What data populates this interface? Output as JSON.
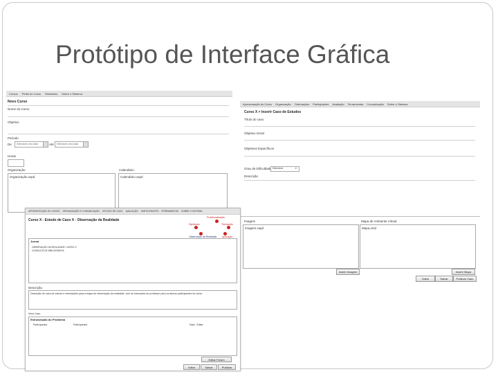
{
  "slide": {
    "title": "Protótipo de Interface Gráfica"
  },
  "shot1": {
    "menu": [
      "Cursos",
      "Perfis do Curso",
      "Relatórios",
      "Sobre o Sistema"
    ],
    "heading": "Novo Curso",
    "fields": {
      "name_label": "Nome do Curso",
      "objectives_label": "Objetivo",
      "period_label": "Período",
      "from_label": "De",
      "from_placeholder": "Selecione uma data",
      "to_label": "Até",
      "to_placeholder": "Selecione uma data",
      "hours_label": "Horas",
      "org_label": "Organização",
      "org_value": "Organização.xspd",
      "calendar_label": "Calendário",
      "calendar_value": "Calendário.xspd"
    }
  },
  "shot2": {
    "menu": [
      "Apresentação do Curso",
      "Organização",
      "Orientações",
      "Participantes",
      "Avaliação",
      "Ferramentas",
      "Comunicação",
      "Sobre o Sistema"
    ],
    "heading": "Curso X > Inserir Caso de Estudos",
    "fields": {
      "name_label": "Título do caso",
      "general_label": "Objetivo Geral",
      "specific_label": "Objetivos Específicos",
      "difficulty_label": "Grau de Dificuldade",
      "difficulty_value": "Selecione",
      "description_label": "Descrição",
      "image_label": "Imagem",
      "image_value": "Imagem.xspd",
      "map_label": "Mapa de Ambiente Virtual",
      "map_value": "Mapa.xmd"
    },
    "buttons": {
      "insert_image": "Inserir Imagem",
      "insert_map": "Inserir Mapa",
      "back": "Voltar",
      "save": "Salvar",
      "publish": "Publicar Caso"
    }
  },
  "shot3": {
    "menu": [
      "APRESENTAÇÃO DO CURSO",
      "ORGANIZAÇÃO E COMUNICAÇÃO",
      "ESTUDO DE CASO",
      "AVALIAÇÃO",
      "PARTICIPANTES",
      "FERRAMENTAS",
      "SOBRE O SISTEMA"
    ],
    "heading": "Curso X - Estudo de Caso X - Observação da Realidade",
    "stages": [
      "Problematização",
      "Hipóteses",
      "Teorização",
      "Observação da Realidade",
      "Aplicação"
    ],
    "journal_label": "Jornal",
    "journal_lines": [
      "OBSERVAÇÃO DA REALIDADE: CURSO X",
      "CONSULTA DE BIBLIOGRAFIA"
    ],
    "description_label": "Descrição",
    "description_text": "Descrição do caso de estudo e orientações para a etapa de observação da realidade, com as instruções do professor para os alunos participantes do curso.",
    "new_item_label": "Novo Caso",
    "table_title": "Estruturação do Problema",
    "table_headers": [
      "Participantes",
      "Participantes",
      "Data - Editar"
    ],
    "buttons": {
      "edit_forum": "Editar Fórum",
      "back": "Voltar",
      "save": "Salvar",
      "publish": "Publicar"
    }
  },
  "colors": {
    "menubar": "#e4e4e4",
    "title": "#555555",
    "stage_red": "#cc2222"
  }
}
